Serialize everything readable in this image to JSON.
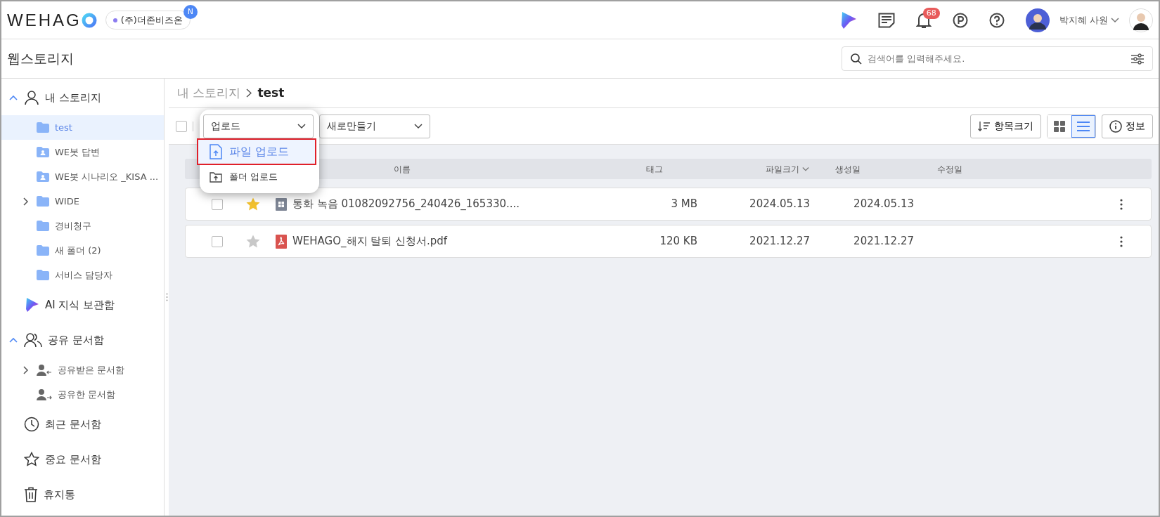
{
  "header": {
    "logo": "WEHAG",
    "company": {
      "name": "(주)더존비즈온",
      "badge": "N"
    },
    "notification_count": "68",
    "user_name": "박지혜 사원"
  },
  "app_title": "웹스토리지",
  "search": {
    "placeholder": "검색어를 입력해주세요."
  },
  "sidebar": {
    "items": [
      {
        "label": "내 스토리지",
        "kind": "user",
        "selected": false,
        "expandable": true,
        "expanded": true,
        "children": [
          {
            "label": "test",
            "kind": "folder",
            "selected": true,
            "expandable": false
          },
          {
            "label": "WE봇 답변",
            "kind": "shared-folder",
            "selected": false,
            "expandable": false
          },
          {
            "label": "WE봇 시나리오 _KISA ...",
            "kind": "shared-folder",
            "selected": false,
            "expandable": false
          },
          {
            "label": "WIDE",
            "kind": "folder",
            "selected": false,
            "expandable": true
          },
          {
            "label": "경비청구",
            "kind": "folder",
            "selected": false,
            "expandable": false
          },
          {
            "label": "새 폴더 (2)",
            "kind": "folder",
            "selected": false,
            "expandable": false
          },
          {
            "label": "서비스 담당자",
            "kind": "folder",
            "selected": false,
            "expandable": false
          }
        ]
      },
      {
        "label": "AI 지식 보관함",
        "kind": "ai",
        "selected": false,
        "expandable": false
      },
      {
        "label": "공유 문서함",
        "kind": "users",
        "selected": false,
        "expandable": true,
        "expanded": true,
        "children": [
          {
            "label": "공유받은 문서함",
            "kind": "shared-in",
            "selected": false,
            "expandable": true
          },
          {
            "label": "공유한 문서함",
            "kind": "shared-out",
            "selected": false,
            "expandable": false
          }
        ]
      },
      {
        "label": "최근 문서함",
        "kind": "clock",
        "selected": false,
        "expandable": false
      },
      {
        "label": "중요 문서함",
        "kind": "star",
        "selected": false,
        "expandable": false
      },
      {
        "label": "휴지통",
        "kind": "trash",
        "selected": false,
        "expandable": false
      }
    ]
  },
  "breadcrumb": [
    "내 스토리지",
    "test"
  ],
  "toolbar": {
    "select_all": {
      "checked": false
    },
    "upload": {
      "label": "업로드",
      "open": true,
      "menu": [
        {
          "label": "파일 업로드",
          "kind": "file",
          "selected": true
        },
        {
          "label": "폴더 업로드",
          "kind": "folder",
          "selected": false
        }
      ]
    },
    "create": {
      "label": "새로만들기"
    },
    "item_size": "항목크기",
    "views": [
      {
        "kind": "grid",
        "selected": false
      },
      {
        "kind": "list",
        "selected": true
      }
    ],
    "info": "정보"
  },
  "table": {
    "columns": [
      {
        "label": "이름",
        "sorted": false
      },
      {
        "label": "태그",
        "sorted": false
      },
      {
        "label": "파일크기",
        "sorted": true
      },
      {
        "label": "생성일",
        "sorted": false
      },
      {
        "label": "수정일",
        "sorted": false
      }
    ],
    "rows": [
      {
        "checked": false,
        "starred": true,
        "kind": "audio",
        "name": "통화 녹음 01082092756_240426_165330....",
        "size": "3 MB",
        "created": "2024.05.13",
        "modified": "2024.05.13"
      },
      {
        "checked": false,
        "starred": false,
        "kind": "pdf",
        "name": "WEHAGO_해지 탈퇴 신청서.pdf",
        "size": "120 KB",
        "created": "2021.12.27",
        "modified": "2021.12.27"
      }
    ]
  }
}
